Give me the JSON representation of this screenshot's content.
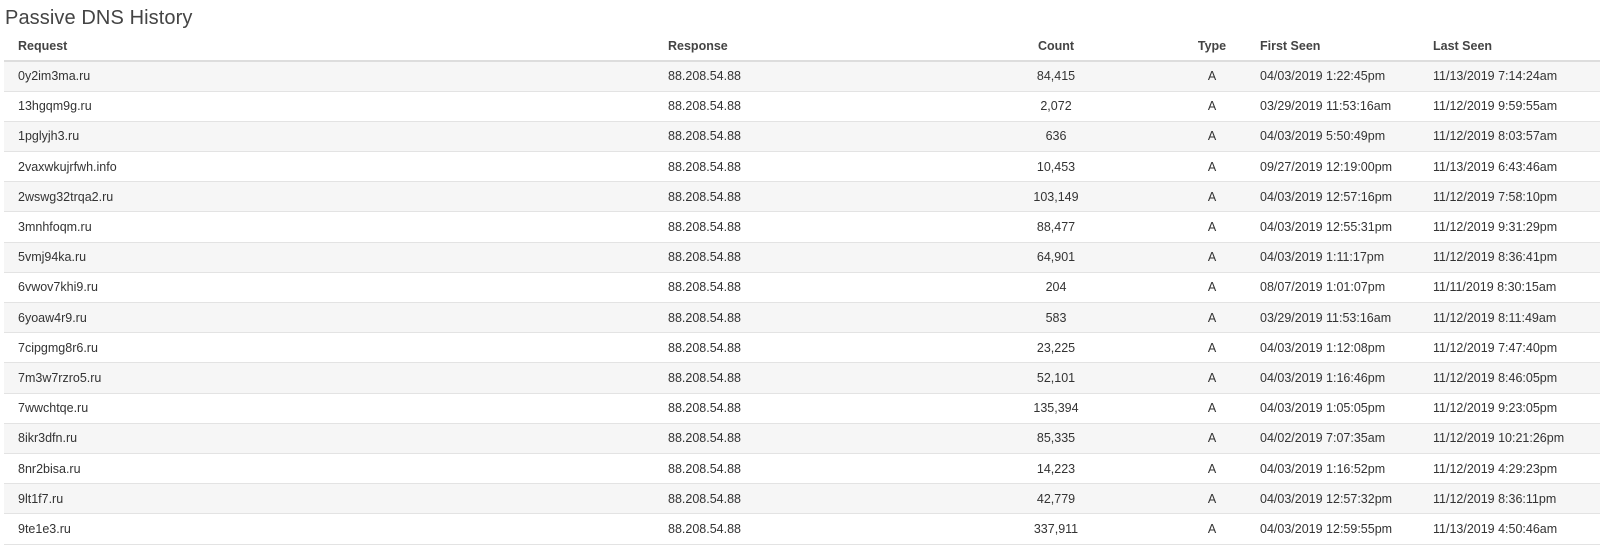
{
  "title": "Passive DNS History",
  "columns": {
    "request": "Request",
    "response": "Response",
    "count": "Count",
    "type": "Type",
    "first_seen": "First Seen",
    "last_seen": "Last Seen"
  },
  "rows": [
    {
      "request": "0y2im3ma.ru",
      "response": "88.208.54.88",
      "count": "84,415",
      "type": "A",
      "first_seen": "04/03/2019 1:22:45pm",
      "last_seen": "11/13/2019 7:14:24am"
    },
    {
      "request": "13hgqm9g.ru",
      "response": "88.208.54.88",
      "count": "2,072",
      "type": "A",
      "first_seen": "03/29/2019 11:53:16am",
      "last_seen": "11/12/2019 9:59:55am"
    },
    {
      "request": "1pglyjh3.ru",
      "response": "88.208.54.88",
      "count": "636",
      "type": "A",
      "first_seen": "04/03/2019 5:50:49pm",
      "last_seen": "11/12/2019 8:03:57am"
    },
    {
      "request": "2vaxwkujrfwh.info",
      "response": "88.208.54.88",
      "count": "10,453",
      "type": "A",
      "first_seen": "09/27/2019 12:19:00pm",
      "last_seen": "11/13/2019 6:43:46am"
    },
    {
      "request": "2wswg32trqa2.ru",
      "response": "88.208.54.88",
      "count": "103,149",
      "type": "A",
      "first_seen": "04/03/2019 12:57:16pm",
      "last_seen": "11/12/2019 7:58:10pm"
    },
    {
      "request": "3mnhfoqm.ru",
      "response": "88.208.54.88",
      "count": "88,477",
      "type": "A",
      "first_seen": "04/03/2019 12:55:31pm",
      "last_seen": "11/12/2019 9:31:29pm"
    },
    {
      "request": "5vmj94ka.ru",
      "response": "88.208.54.88",
      "count": "64,901",
      "type": "A",
      "first_seen": "04/03/2019 1:11:17pm",
      "last_seen": "11/12/2019 8:36:41pm"
    },
    {
      "request": "6vwov7khi9.ru",
      "response": "88.208.54.88",
      "count": "204",
      "type": "A",
      "first_seen": "08/07/2019 1:01:07pm",
      "last_seen": "11/11/2019 8:30:15am"
    },
    {
      "request": "6yoaw4r9.ru",
      "response": "88.208.54.88",
      "count": "583",
      "type": "A",
      "first_seen": "03/29/2019 11:53:16am",
      "last_seen": "11/12/2019 8:11:49am"
    },
    {
      "request": "7cipgmg8r6.ru",
      "response": "88.208.54.88",
      "count": "23,225",
      "type": "A",
      "first_seen": "04/03/2019 1:12:08pm",
      "last_seen": "11/12/2019 7:47:40pm"
    },
    {
      "request": "7m3w7rzro5.ru",
      "response": "88.208.54.88",
      "count": "52,101",
      "type": "A",
      "first_seen": "04/03/2019 1:16:46pm",
      "last_seen": "11/12/2019 8:46:05pm"
    },
    {
      "request": "7wwchtqe.ru",
      "response": "88.208.54.88",
      "count": "135,394",
      "type": "A",
      "first_seen": "04/03/2019 1:05:05pm",
      "last_seen": "11/12/2019 9:23:05pm"
    },
    {
      "request": "8ikr3dfn.ru",
      "response": "88.208.54.88",
      "count": "85,335",
      "type": "A",
      "first_seen": "04/02/2019 7:07:35am",
      "last_seen": "11/12/2019 10:21:26pm"
    },
    {
      "request": "8nr2bisa.ru",
      "response": "88.208.54.88",
      "count": "14,223",
      "type": "A",
      "first_seen": "04/03/2019 1:16:52pm",
      "last_seen": "11/12/2019 4:29:23pm"
    },
    {
      "request": "9lt1f7.ru",
      "response": "88.208.54.88",
      "count": "42,779",
      "type": "A",
      "first_seen": "04/03/2019 12:57:32pm",
      "last_seen": "11/12/2019 8:36:11pm"
    },
    {
      "request": "9te1e3.ru",
      "response": "88.208.54.88",
      "count": "337,911",
      "type": "A",
      "first_seen": "04/03/2019 12:59:55pm",
      "last_seen": "11/13/2019 4:50:46am"
    }
  ]
}
